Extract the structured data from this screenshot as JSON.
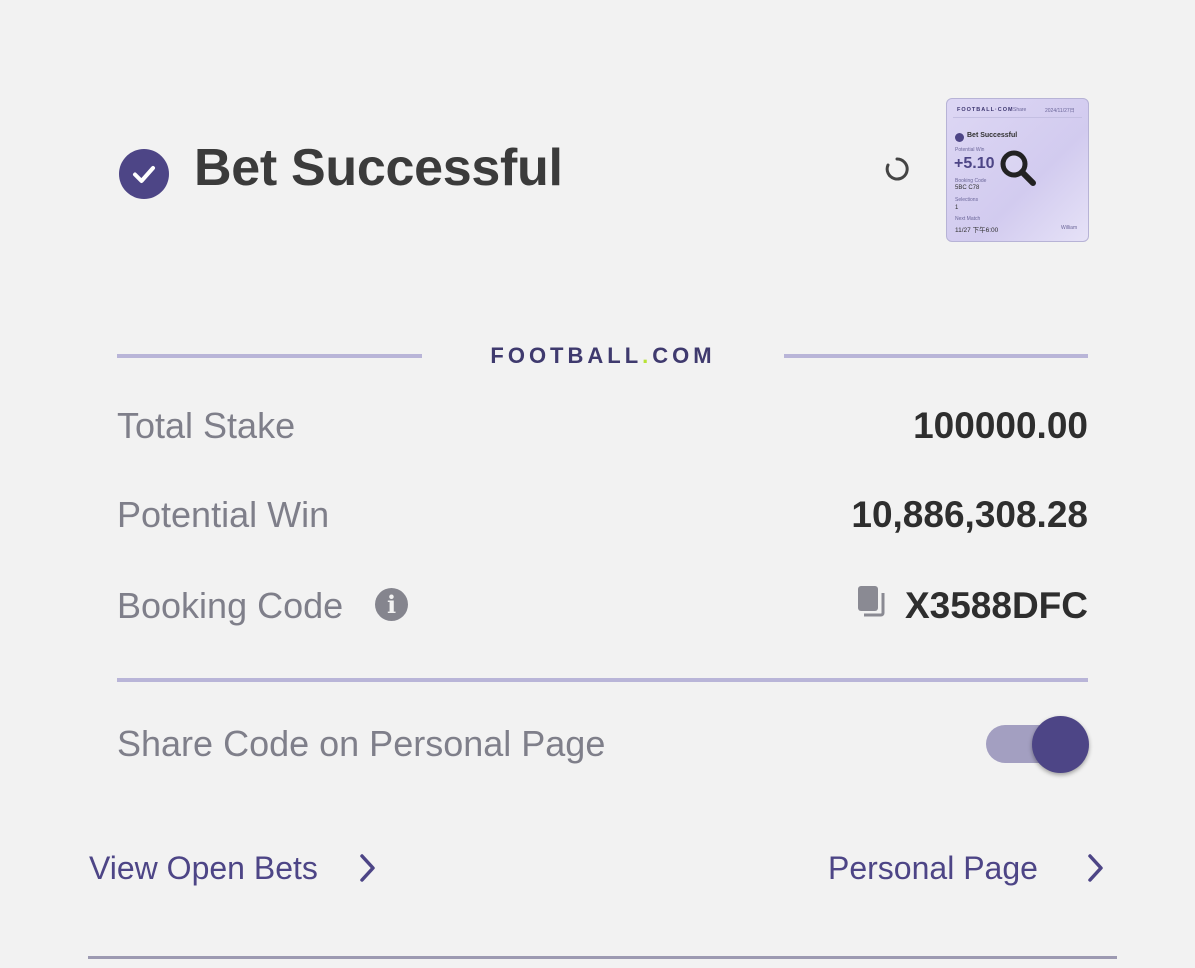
{
  "header": {
    "title": "Bet Successful",
    "check_icon": "check-circle-icon",
    "loading_icon": "loading-spinner-icon"
  },
  "thumbnail": {
    "brand": "FOOTBALL·COM",
    "share": "Share",
    "date": "2024/11/27日",
    "heading": "Bet Successful",
    "potential_win_label": "Potential Win",
    "potential_win_value": "+5.10",
    "booking_code_label": "Booking Code",
    "booking_code_value": "5BC C78",
    "selections_label": "Selections",
    "selections_value": "1",
    "next_match_label": "Next Match",
    "next_match_value": "11/27 下午6:00",
    "user": "William",
    "zoom_icon": "magnifier-icon"
  },
  "brand": {
    "name_left": "FOOTBALL",
    "dot": ".",
    "name_right": "COM"
  },
  "summary": {
    "total_stake_label": "Total Stake",
    "total_stake_value": "100000.00",
    "potential_win_label": "Potential Win",
    "potential_win_value": "10,886,308.28",
    "booking_code_label": "Booking Code",
    "booking_code_value": "X3588DFC",
    "info_icon": "i"
  },
  "share": {
    "label": "Share Code on Personal Page",
    "enabled": true
  },
  "links": {
    "open_bets": "View Open Bets",
    "personal_page": "Personal Page"
  },
  "colors": {
    "accent": "#4d4586",
    "divider": "#b9b5d8",
    "brand_dot": "#b8e236",
    "background": "#f2f2f2"
  }
}
